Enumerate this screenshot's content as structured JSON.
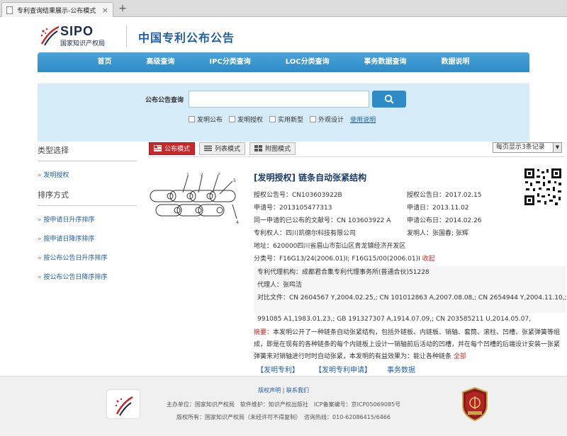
{
  "browser": {
    "tab_title": "专利查询结果展示-公布模式",
    "close_glyph": "×",
    "newtab_glyph": "+"
  },
  "header": {
    "logo_text": "SIPO",
    "logo_cn": "国家知识产权局",
    "site_title": "中国专利公布公告"
  },
  "nav": {
    "items": [
      "首页",
      "高级查询",
      "IPC分类查询",
      "LOC分类查询",
      "事务数据查询",
      "数据说明"
    ]
  },
  "search": {
    "label": "公布公告查询",
    "value": "",
    "options": [
      "发明公布",
      "发明授权",
      "实用新型",
      "外观设计"
    ],
    "help": "使用说明"
  },
  "sidebar": {
    "type_heading": "类型选择",
    "type_items": [
      "发明授权"
    ],
    "sort_heading": "排序方式",
    "sort_items": [
      "按申请日升序排序",
      "按申请日降序排序",
      "按公布公告日升序排序",
      "按公布公告日降序排序"
    ]
  },
  "modes": {
    "items": [
      "公布模式",
      "列表模式",
      "附图模式"
    ],
    "per_page": "每页显示3条记录"
  },
  "record": {
    "title": "[发明授权] 链条自动张紧结构",
    "pub_no": "授权公告号：CN103603922B",
    "pub_date": "授权公告日：2017.02.15",
    "app_no": "申请号：2013105477313",
    "app_date": "申请日：2013.11.02",
    "same_app": "同一申请的已公布的文献号：CN 103603922 A",
    "same_app_date": "申请公布日：2014.02.26",
    "patentee": "专利权人：四川凯德尔科技有限公司",
    "inventor": "发明人：张国春; 张辉",
    "address": "地址：620000四川省眉山市彭山区青龙镇经济开发区",
    "class_no": "分类号：F16G13/24(2006.01)I; F16G15/00(2006.01)I",
    "collapse": "收起",
    "agency": "专利代理机构：成都君合集专利代理事务所(普通合伙)51228",
    "agent": "代理人：张鸣洁",
    "refs_1": "对比文件：CN 2604567 Y,2004.02.25,; CN 101012863 A,2007.08.08,; CN 2654944 Y,2004.11.10,; SU",
    "refs_2": "991085 A1,1983.01.23,; GB 191327307 A,1914.07.09,; CN 203585211 U,2014.05.07,",
    "abstract_label": "摘要：",
    "abstract_text": "本发明公开了一种链条自动张紧结构，包括外链板、内链板、销轴、套筒、滚柱、凹槽、张紧弹簧等组成，即是在现有的各种链条的每个内链板上设计一销轴前后活动的凹槽，并在每个凹槽的后端设计安装一张紧弹簧来对销轴进行时时自动张紧，本发明的有益效果为：能让各种链条",
    "abstract_more": "全部",
    "links": [
      "【发明专利】",
      "【发明专利申请】",
      "事务数据"
    ]
  },
  "footer": {
    "link_1": "版权声明",
    "sep": "|",
    "link_2": "联系我们",
    "line_1": "主办单位：国家知识产权局　软件维护：知识产权出版社　ICP备案编号：京ICP05069085号",
    "line_2": "版权所有：国家知识产权局（未经许可不得复制）　咨询热线：010-62086415/6466"
  },
  "colors": {
    "accent": "#2f8bc6",
    "title_blue": "#1f5fa8",
    "active_red": "#c8282a"
  }
}
